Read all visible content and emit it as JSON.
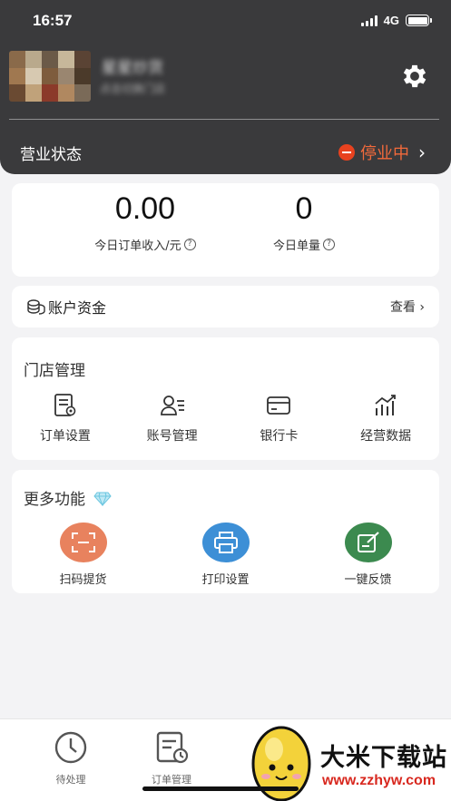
{
  "status_bar": {
    "time": "16:57",
    "network": "4G"
  },
  "header": {
    "store_name": "星星炒货",
    "store_sub": "点击切换门店",
    "settings_icon": "gear-icon",
    "business_label": "营业状态",
    "business_status": "停业中",
    "status_color": "#f26a3b"
  },
  "stats": {
    "income_value": "0.00",
    "income_label": "今日订单收入/元",
    "orders_value": "0",
    "orders_label": "今日单量"
  },
  "funds": {
    "title": "账户资金",
    "view_label": "查看"
  },
  "store_management": {
    "title": "门店管理",
    "items": [
      {
        "label": "订单设置",
        "icon": "order-settings-icon"
      },
      {
        "label": "账号管理",
        "icon": "account-management-icon"
      },
      {
        "label": "银行卡",
        "icon": "bank-card-icon"
      },
      {
        "label": "经营数据",
        "icon": "business-data-icon"
      }
    ]
  },
  "more_functions": {
    "title": "更多功能",
    "items": [
      {
        "label": "扫码提货",
        "icon": "scan-icon",
        "color": "#e8825e"
      },
      {
        "label": "打印设置",
        "icon": "printer-icon",
        "color": "#3d8fd6"
      },
      {
        "label": "一键反馈",
        "icon": "feedback-icon",
        "color": "#3c8a4f"
      }
    ]
  },
  "tabbar": {
    "items": [
      {
        "label": "待处理",
        "icon": "clock-icon"
      },
      {
        "label": "订单管理",
        "icon": "order-list-icon"
      }
    ]
  },
  "watermark": {
    "title": "大米下载站",
    "url": "www.zzhyw.com"
  }
}
